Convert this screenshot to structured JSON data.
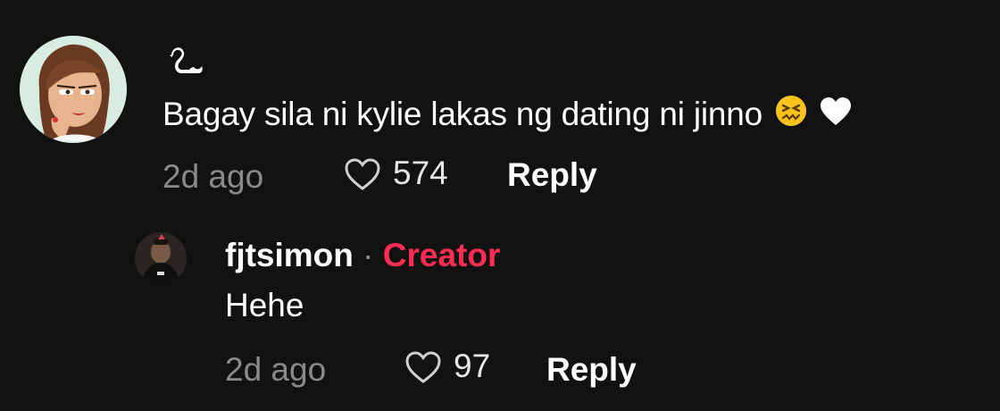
{
  "comment": {
    "username_icon": "swan-icon",
    "text": "Bagay sila ni kylie lakas ng dating ni jinno",
    "emojis": [
      "confounded-face-emoji",
      "white-heart-emoji"
    ],
    "time": "2d ago",
    "likes": "574",
    "reply_label": "Reply"
  },
  "reply": {
    "username": "fjtsimon",
    "separator": "·",
    "badge": "Creator",
    "text": "Hehe",
    "time": "2d ago",
    "likes": "97",
    "reply_label": "Reply"
  },
  "colors": {
    "background": "#121212",
    "creator_badge": "#fe2c55",
    "muted": "#8a8a8a"
  }
}
